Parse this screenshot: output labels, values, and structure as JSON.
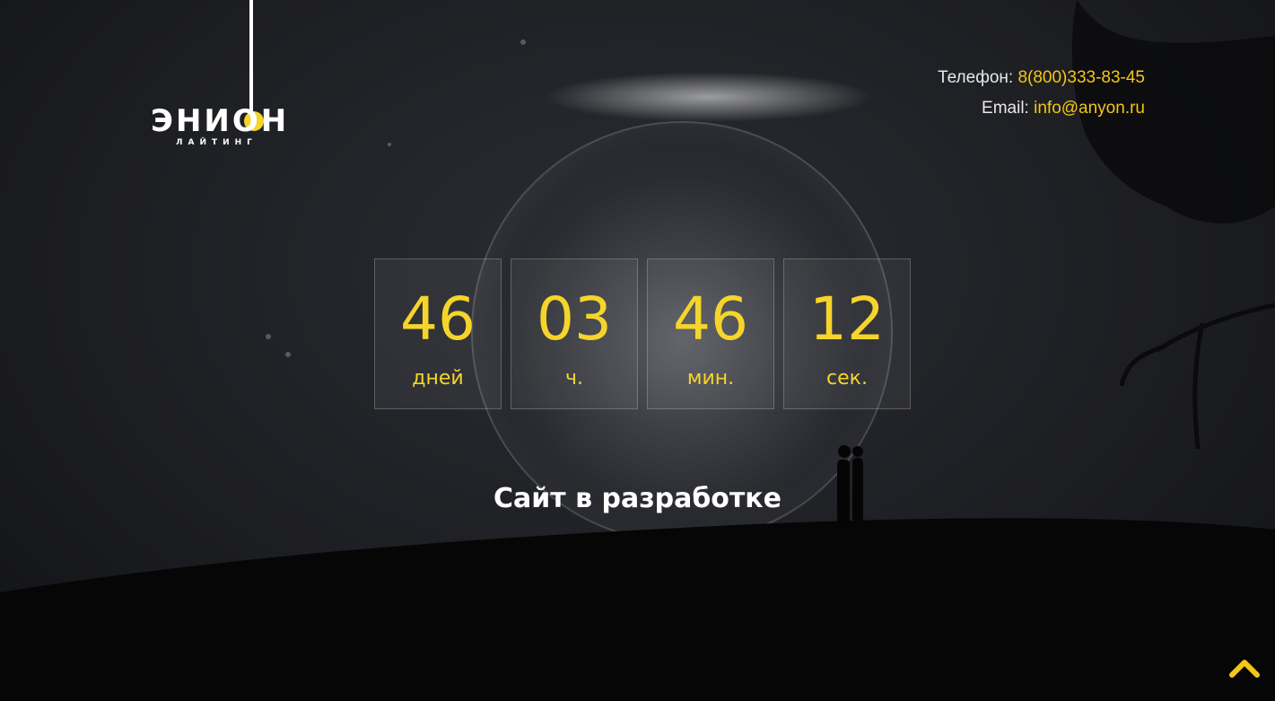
{
  "logo": {
    "name": "ЭНИОН",
    "tagline": "ЛАЙТИНГ"
  },
  "contacts": {
    "phone_label": "Телефон:",
    "phone_value": "8(800)333-83-45",
    "email_label": "Email:",
    "email_value": "info@anyon.ru"
  },
  "countdown": [
    {
      "value": "46",
      "unit": "дней"
    },
    {
      "value": "03",
      "unit": "ч."
    },
    {
      "value": "46",
      "unit": "мин."
    },
    {
      "value": "12",
      "unit": "сек."
    }
  ],
  "status_text": "Сайт в разработке",
  "icons": {
    "back_to_top": "chevron-up-icon"
  },
  "colors": {
    "accent": "#f5d52a",
    "text": "#ffffff"
  }
}
